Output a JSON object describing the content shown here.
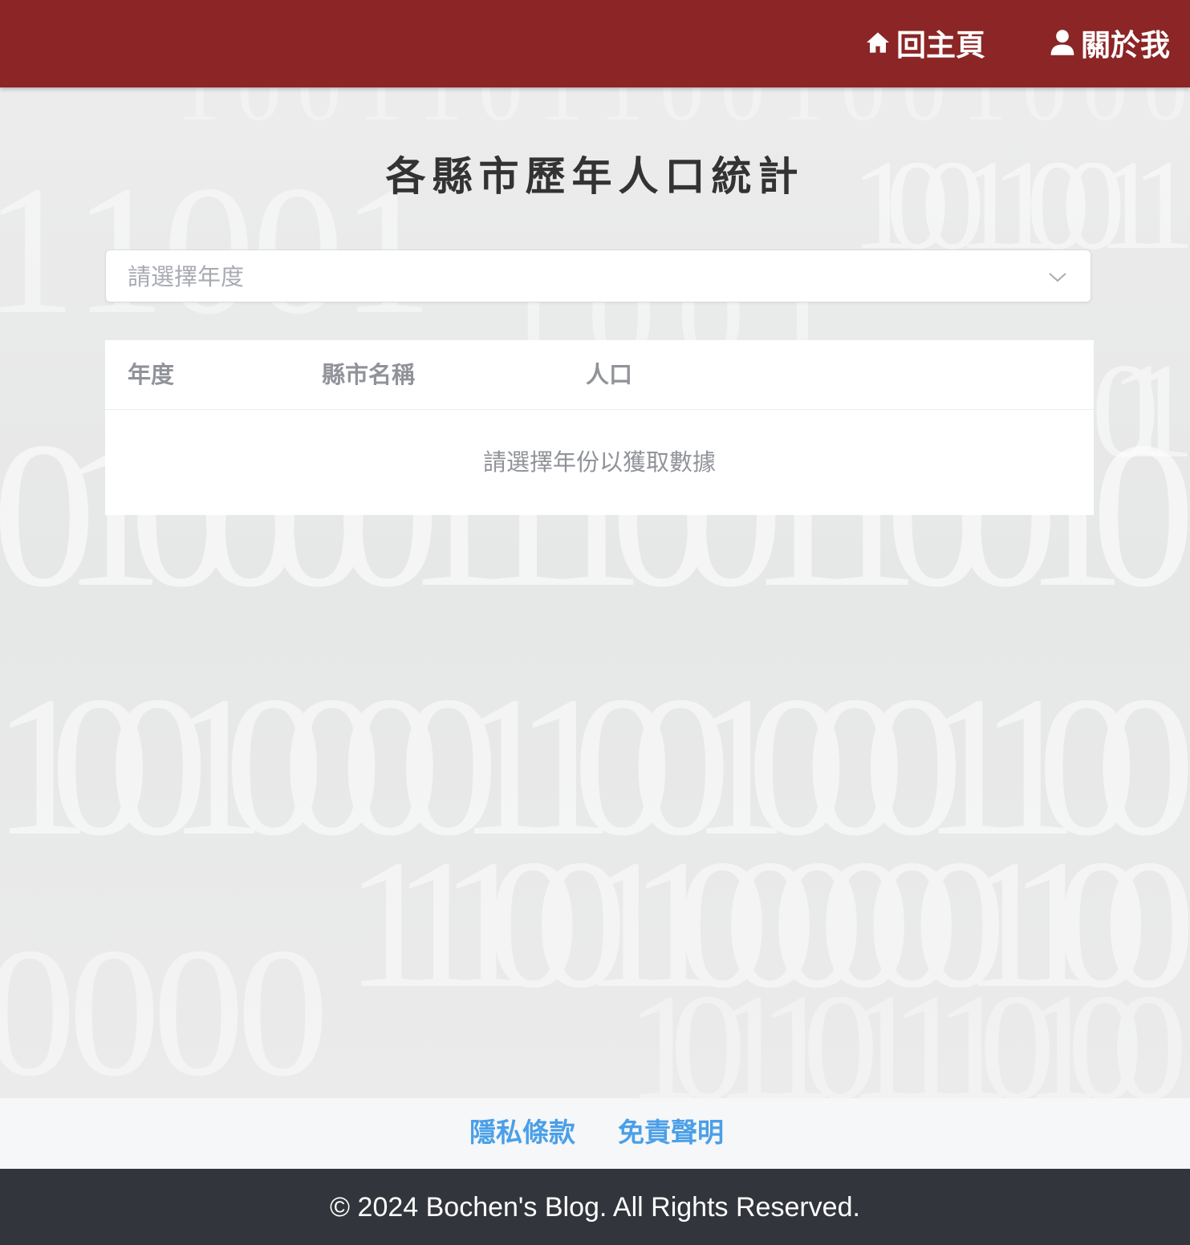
{
  "header": {
    "home_label": "回主頁",
    "about_label": "關於我",
    "background_color": "#8b2526"
  },
  "main": {
    "title": "各縣市歷年人口統計",
    "year_select": {
      "placeholder": "請選擇年度"
    },
    "table": {
      "columns": [
        "年度",
        "縣市名稱",
        "人口"
      ],
      "rows": [],
      "empty_text": "請選擇年份以獲取數據"
    }
  },
  "footer": {
    "links": [
      "隱私條款",
      "免責聲明"
    ],
    "link_color": "#4a9fe8",
    "copyright": "© 2024 Bochen's Blog. All Rights Reserved."
  },
  "icons": {
    "home": "home-icon",
    "about": "user-icon",
    "select": "chevron-down-icon"
  }
}
